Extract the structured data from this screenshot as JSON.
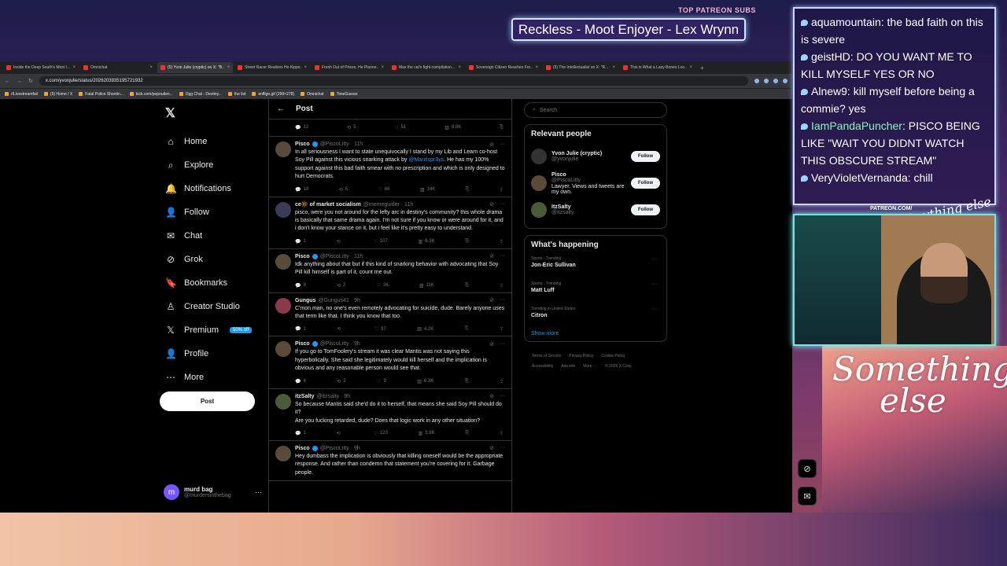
{
  "browser": {
    "tabs": [
      {
        "label": "Inside the Deep South's Most I..."
      },
      {
        "label": "Omnichat"
      },
      {
        "label": "(5) Yvon Julie (cryptic) on X: \"B..."
      },
      {
        "label": "Street Racer Realizes He Kippe..."
      },
      {
        "label": "Fresh Out of Prison, He Planne..."
      },
      {
        "label": "Max the cat's fight compilation..."
      },
      {
        "label": "Sovereign Citizen Reaches For..."
      },
      {
        "label": "(5) The Intellectualist on X: \"R..."
      },
      {
        "label": "This is What a Lazy-Bones Loo..."
      }
    ],
    "url": "x.com/yvonjulie/status/2026203935195721932",
    "bookmarks": [
      "r/Livestreamfail",
      "(5) Home / X",
      "Fatal Police Shootin...",
      "kick.com/popoutlen...",
      "Dgg Chat - Destiny...",
      "the list",
      "enflige.gif (299×278)",
      "Omnichat",
      "TimeGuessr"
    ]
  },
  "nav": {
    "items": [
      "Home",
      "Explore",
      "Notifications",
      "Follow",
      "Chat",
      "Grok",
      "Bookmarks",
      "Creator Studio",
      "Premium",
      "Profile",
      "More"
    ],
    "premium_badge": "50% off",
    "post_button": "Post",
    "account": {
      "initial": "m",
      "name": "murd bag",
      "handle": "@murdersinthebag"
    }
  },
  "feed": {
    "title": "Post",
    "top_stats": {
      "replies": "12",
      "reposts": "5",
      "likes": "51",
      "views": "8.8K"
    },
    "tweets": [
      {
        "name": "Pisco",
        "handle": "@PiscoLitty · 11h",
        "text_before": "In all seriousness I want to state unequivocally I stand by my Lib and Learn co-host Soy Pill against this vicious snarking attack by ",
        "mention": "@Mantispr3ys",
        "text_after": ". He has my 100% support against this bad faith smear with no prescription and which is only designed to hurt Democrats.",
        "replies": "19",
        "reposts": "5",
        "likes": "66",
        "views": "14K"
      },
      {
        "name": "ce🔆 of market socialism",
        "handle": "@memeguider · 11h",
        "text": "pisco, were you not around for the lefty arc in destiny's community? this whole drama is basically that same drama again. I'm not sure if you know or were around for it, and i don't know your stance on it, but i feel like it's pretty easy to understand.",
        "replies": "1",
        "reposts": "",
        "likes": "107",
        "views": "6.3K"
      },
      {
        "name": "Pisco",
        "handle": "@PiscoLitty · 11h",
        "text": "Idk anything about that but if this kind of snarking behavior with advocating that Soy Pill kill himself is part of it, count me out.",
        "replies": "9",
        "reposts": "2",
        "likes": "26",
        "views": "11K"
      },
      {
        "name": "Gungus",
        "handle": "@Gungus41 · 9h",
        "text": "C'mon man, no one's even remotely advocating for suicide, dude. Barely anyone uses that term like that. I think you know that too.",
        "replies": "1",
        "reposts": "",
        "likes": "97",
        "views": "4.2K"
      },
      {
        "name": "Pisco",
        "handle": "@PiscoLitty · 9h",
        "text": "If you go to TomFoolery's stream it was clear Mantis was not saying this hyperbolically. She said she legitimately would kill herself and the implication is obvious and any reasonable person would see that.",
        "replies": "4",
        "reposts": "2",
        "likes": "9",
        "views": "6.3K"
      },
      {
        "name": "itzSalty",
        "handle": "@itzsalty · 9h",
        "text": "So because Mantis said she'd do it to herself, that means she said Soy Pill should do it?\nAre you fucking retarded, dude? Does that logic work in any other situation?",
        "replies": "1",
        "reposts": "",
        "likes": "123",
        "views": "3.9K"
      },
      {
        "name": "Pisco",
        "handle": "@PiscoLitty · 9h",
        "text": "Hey dumbass the implication is obviously that killing oneself would be the appropriate response. And rather than condemn that statement you're covering for it. Garbage people.",
        "replies": "",
        "reposts": "",
        "likes": "",
        "views": ""
      }
    ]
  },
  "right": {
    "search_placeholder": "Search",
    "relevant_title": "Relevant people",
    "people": [
      {
        "name": "Yvon Julie (cryptic)",
        "handle": "@yvonjulie",
        "bio": "",
        "button": "Follow"
      },
      {
        "name": "Pisco",
        "handle": "@PiscoLitty",
        "bio": "Lawyer. Views and tweets are my own.",
        "button": "Follow"
      },
      {
        "name": "ItzSalty",
        "handle": "@itzsalty",
        "bio": "",
        "button": "Follow"
      }
    ],
    "happening_title": "What's happening",
    "trends": [
      {
        "context": "Sports · Trending",
        "topic": "Jon-Eric Sullivan"
      },
      {
        "context": "Sports · Trending",
        "topic": "Matt Luff"
      },
      {
        "context": "Trending in United States",
        "topic": "Citron"
      }
    ],
    "show_more": "Show more",
    "footer": [
      "Terms of Service",
      "Privacy Policy",
      "Cookie Policy",
      "Accessibility",
      "Ads info",
      "More ···",
      "© 2026 X Corp."
    ]
  },
  "overlay": {
    "top_label": "TOP PATREON SUBS",
    "title": "Reckless - Moot Enjoyer - Lex Wrynn",
    "chat": [
      {
        "user": "aquamountain",
        "text": ": the bad faith on this is severe",
        "green": false
      },
      {
        "user": "geistHD",
        "text": ": DO YOU WANT ME TO KILL MYSELF YES OR NO",
        "green": false
      },
      {
        "user": "Alnew9",
        "text": ": kill myself before being a commie? yes",
        "green": false
      },
      {
        "user": "IamPandaPuncher",
        "text": ": PISCO BEING LIKE \"WAIT YOU DIDNT WATCH THIS OBSCURE STREAM\"",
        "green": true
      },
      {
        "user": "VeryVioletVernanda",
        "text": ": chill",
        "green": false
      }
    ],
    "patreon": "PATREON.COM/",
    "logo_script": "Anything else",
    "something_line1": "Something",
    "something_line2": "else"
  },
  "colors": {
    "accent": "#1d9bf0",
    "bg": "#000000",
    "text": "#e7e9ea",
    "muted": "#71767b"
  }
}
